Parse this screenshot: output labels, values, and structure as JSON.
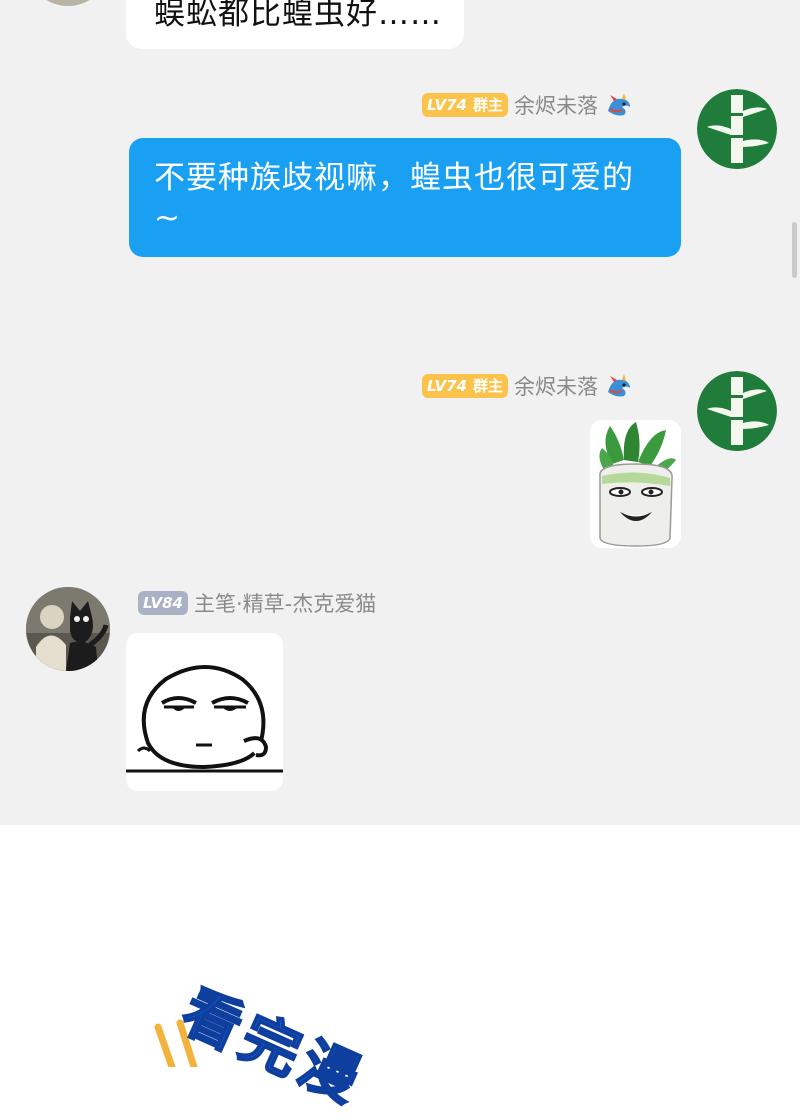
{
  "messages": [
    {
      "text": "蜈蚣都比蝗虫好……"
    },
    {
      "badge_level": "LV74",
      "badge_role": "群主",
      "nickname": "余烬未落",
      "text": "不要种族歧视嘛，蝗虫也很可爱的~"
    },
    {
      "badge_level": "LV74",
      "badge_role": "群主",
      "nickname": "余烬未落",
      "sticker": "radish-face-sticker"
    },
    {
      "badge_level": "LV84",
      "nickname": "主笔·精草-杰克爱猫",
      "sticker": "sleepy-face-sticker"
    }
  ],
  "promo": {
    "text": "看完漫"
  },
  "colors": {
    "chat_bg": "#f1f1f1",
    "bubble_blue": "#1aa0f2",
    "badge_gold": "#fbc34c",
    "badge_gray": "#aab1c4",
    "promo_blue": "#1d5fd0"
  },
  "icons": {
    "nick_icon": "dragon-icon",
    "avatar_1": "bamboo-avatar",
    "avatar_2": "cat-avatar"
  }
}
